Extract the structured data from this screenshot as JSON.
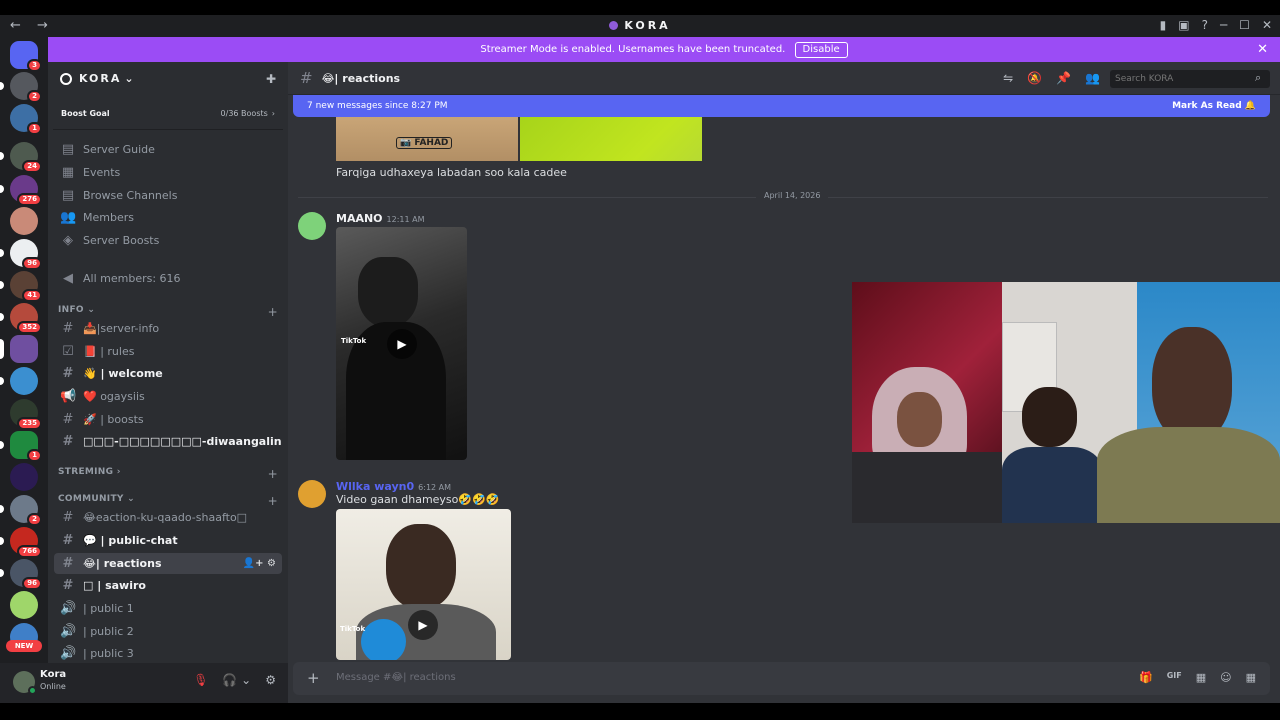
{
  "titlebar": {
    "nav": "←  →",
    "title": "KORA",
    "right_icons": [
      "bookmark-icon",
      "inbox-icon",
      "help-icon",
      "minimize-icon",
      "maximize-icon",
      "close-icon"
    ],
    "icon_glyphs": [
      "▮",
      "▣",
      "?",
      "─",
      "☐",
      "✕"
    ]
  },
  "streamer_banner": {
    "text": "Streamer Mode is enabled. Usernames have been truncated.",
    "button": "Disable",
    "close": "✕"
  },
  "server_rail": {
    "badges": [
      "3",
      "2",
      "1",
      "24",
      "276",
      "96",
      "41",
      "352",
      "235",
      "1",
      "2",
      "766",
      "96"
    ],
    "new_label": "NEW"
  },
  "guild": {
    "name": "KORA",
    "chevron": "⌄",
    "invite_icon": "✚"
  },
  "boost": {
    "title": "Boost Goal",
    "count": "0/36 Boosts",
    "arrow": "›"
  },
  "menu": [
    {
      "icon": "▤",
      "label": "Server Guide"
    },
    {
      "icon": "▦",
      "label": "Events"
    },
    {
      "icon": "▤",
      "label": "Browse Channels"
    },
    {
      "icon": "👥",
      "label": "Members"
    },
    {
      "icon": "◈",
      "label": "Server Boosts"
    },
    {
      "icon": "◀",
      "label": "All members: 616"
    }
  ],
  "categories": {
    "info": {
      "label": "INFO ⌄",
      "plus": "+"
    },
    "streming": {
      "label": "STREMING ›",
      "plus": "+"
    },
    "community": {
      "label": "COMMUNITY ⌄",
      "plus": "+"
    }
  },
  "channels": [
    {
      "icon": "#",
      "label": "📥|server-info"
    },
    {
      "icon": "☑",
      "label": "📕 | rules"
    },
    {
      "icon": "#",
      "label": "👋 | welcome"
    },
    {
      "icon": "📢",
      "label": "❤️ ogaysiis"
    },
    {
      "icon": "#",
      "label": "🚀 | boosts"
    },
    {
      "icon": "#",
      "label": "□□□-□□□□□□□□-diwaangalin"
    },
    {
      "icon": "#",
      "label": "😂eaction-ku-qaado-shaafto□"
    },
    {
      "icon": "#",
      "label": "💬 | public-chat"
    },
    {
      "icon": "#",
      "label": "😂| reactions",
      "tail": "👤+ ⚙"
    },
    {
      "icon": "#",
      "label": "□ | sawiro"
    },
    {
      "icon": "🔊",
      "label": "| public 1"
    },
    {
      "icon": "🔊",
      "label": "| public 2"
    },
    {
      "icon": "🔊",
      "label": "| public 3"
    }
  ],
  "user": {
    "name": "Kora",
    "status": "Online",
    "controls": [
      "🎙",
      "🎧 ⌄",
      "⚙"
    ]
  },
  "channel_header": {
    "hash": "#",
    "name": "😂| reactions",
    "icons": [
      "⇋",
      "🔕",
      "📌",
      "👥"
    ],
    "search_placeholder": "Search KORA",
    "search_icon": "⌕"
  },
  "new_messages": {
    "text": "7 new messages since 8:27 PM",
    "action": "Mark As Read 🔔"
  },
  "messages": {
    "prev_watermark": "📷 FAHAD",
    "prev_text": "Farqiga udhaxeya labadan soo kala cadee",
    "date_divider": "April 14, 2026",
    "msg1": {
      "author": "MAANO",
      "time": "12:11 AM",
      "tiktok": "TikTok"
    },
    "msg2": {
      "author": "Wllka wayn0",
      "time": "6:12 AM",
      "text": "Video gaan dhameyso🤣🤣🤣",
      "tiktok": "TikTok"
    },
    "play_icon": "▶"
  },
  "composer": {
    "plus": "+",
    "placeholder": "Message #😂| reactions",
    "icons": [
      "🎁",
      "GIF",
      "▦",
      "☺",
      "▦"
    ]
  },
  "colors": {
    "accent": "#5865f2",
    "streamer": "#9b4cf5",
    "danger": "#f23f43",
    "online": "#23a55a"
  }
}
